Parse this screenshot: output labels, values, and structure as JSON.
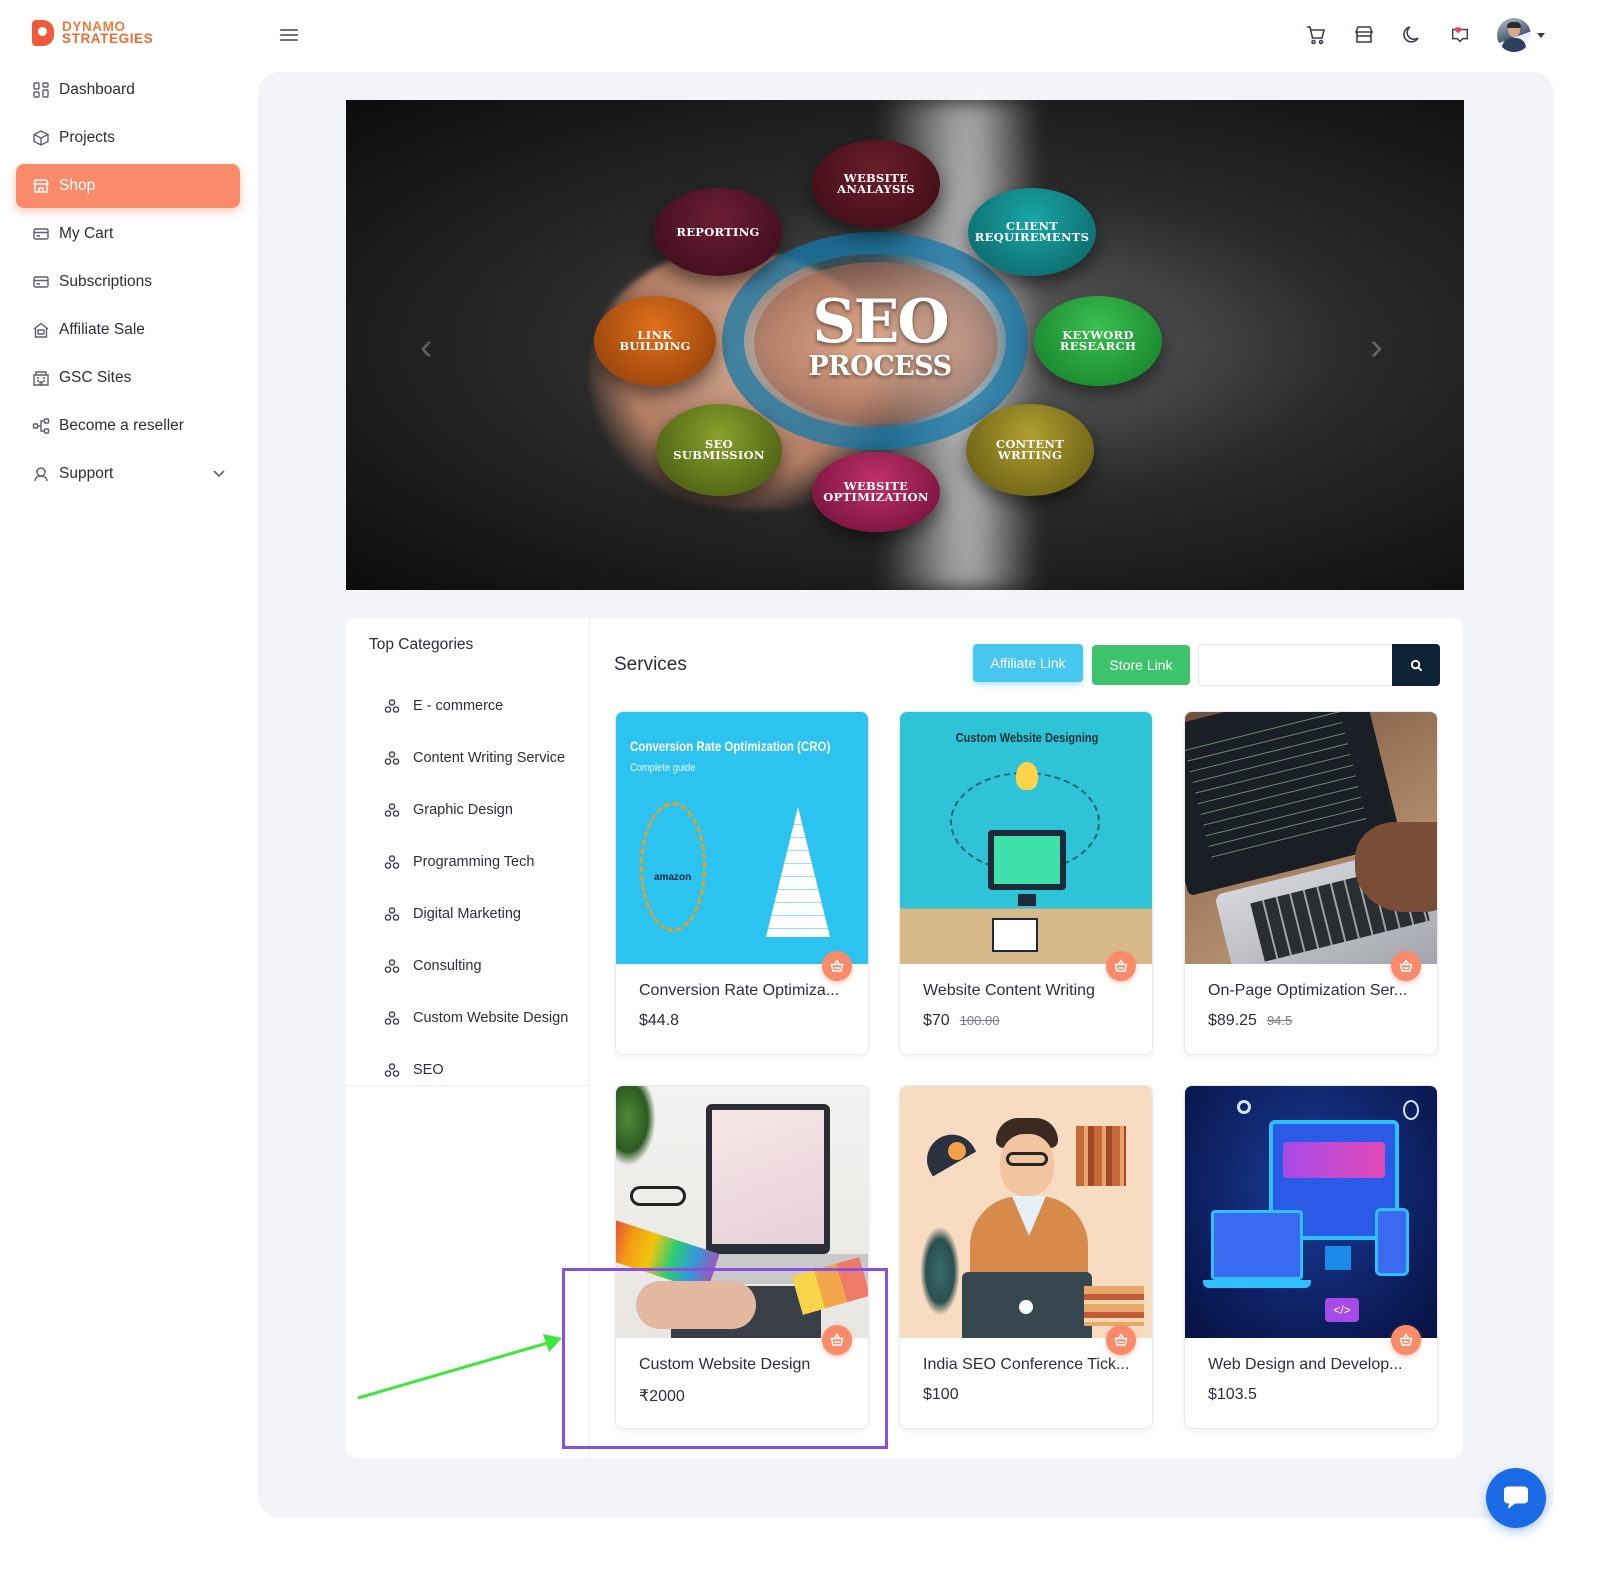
{
  "brand": {
    "line1": "DYNAMO",
    "line2": "STRATEGIES",
    "logo_icon": "brand-logo-icon"
  },
  "sidebar": {
    "items": [
      {
        "label": "Dashboard",
        "icon": "dashboard-grid-icon",
        "active": false
      },
      {
        "label": "Projects",
        "icon": "box-icon",
        "active": false
      },
      {
        "label": "Shop",
        "icon": "store-icon",
        "active": true
      },
      {
        "label": "My Cart",
        "icon": "card-icon",
        "active": false
      },
      {
        "label": "Subscriptions",
        "icon": "card-icon",
        "active": false
      },
      {
        "label": "Affiliate Sale",
        "icon": "house-money-icon",
        "active": false
      },
      {
        "label": "GSC Sites",
        "icon": "building-icon",
        "active": false
      },
      {
        "label": "Become a reseller",
        "icon": "network-icon",
        "active": false
      },
      {
        "label": "Support",
        "icon": "headset-icon",
        "active": false,
        "expandable": true
      }
    ]
  },
  "topbar": {
    "icons": [
      "cart-icon",
      "store-icon",
      "moon-icon",
      "notification-heart-icon",
      "user-avatar"
    ],
    "menu_icon": "hamburger-icon"
  },
  "banner": {
    "title": "SEO",
    "subtitle": "PROCESS",
    "bubbles": {
      "website_analysis": "WEBSITE\nANALAYSIS",
      "reporting": "REPORTING",
      "client_requirements": "CLIENT\nREQUIREMENTS",
      "link_building": "LINK\nBUILDING",
      "keyword_research": "KEYWORD\nRESEARCH",
      "seo_submission": "SEO\nSUBMISSION",
      "content_writing": "CONTENT\nWRITING",
      "website_optimization": "WEBSITE\nOPTIMIZATION"
    },
    "prev_arrow": "‹",
    "next_arrow": "›"
  },
  "categories": {
    "title": "Top Categories",
    "items": [
      "E - commerce",
      "Content Writing Service",
      "Graphic Design",
      "Programming Tech",
      "Digital Marketing",
      "Consulting",
      "Custom Website Design",
      "SEO"
    ]
  },
  "services": {
    "title": "Services",
    "affiliate_link_label": "Affiliate Link",
    "store_link_label": "Store Link",
    "search_value": "",
    "search_placeholder": "",
    "products": [
      {
        "name": "Conversion Rate Optimiza...",
        "price": "$44.8",
        "old_price": "",
        "image": "cro-guide-image",
        "image_text": "Conversion Rate Optimization (CRO)",
        "image_subtext": "Complete guide"
      },
      {
        "name": "Website Content Writing",
        "price": "$70",
        "old_price": "100.00",
        "image": "custom-website-designing-image",
        "image_text": "Custom Website Designing"
      },
      {
        "name": "On-Page Optimization Ser...",
        "price": "$89.25",
        "old_price": "94.5",
        "image": "laptop-code-image"
      },
      {
        "name": "Custom Website Design",
        "price": "₹2000",
        "old_price": "",
        "image": "web-design-workspace-image"
      },
      {
        "name": "India SEO Conference Tick...",
        "price": "$100",
        "old_price": "",
        "image": "seo-conference-illustration"
      },
      {
        "name": "Web Design and Develop...",
        "price": "$103.5",
        "old_price": "",
        "image": "responsive-design-illustration"
      }
    ]
  },
  "colors": {
    "accent": "#f98a6a",
    "affiliate_button": "#47c6ef",
    "store_button": "#3cc36b",
    "search_button": "#0e2236",
    "highlight_box": "#8a4ee0",
    "annotation_arrow": "#3ee83a",
    "chat_button": "#1a6ae6"
  }
}
